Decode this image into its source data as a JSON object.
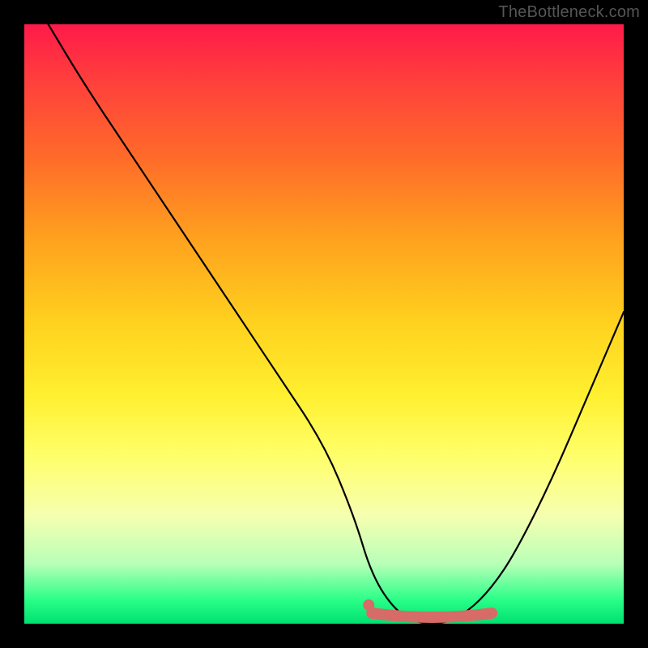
{
  "watermark": "TheBottleneck.com",
  "chart_data": {
    "type": "line",
    "title": "",
    "xlabel": "",
    "ylabel": "",
    "xlim": [
      0,
      100
    ],
    "ylim": [
      0,
      100
    ],
    "grid": false,
    "series": [
      {
        "name": "bottleneck-curve",
        "x": [
          4,
          10,
          18,
          26,
          34,
          42,
          50,
          55,
          58,
          62,
          66,
          70,
          74,
          78,
          82,
          88,
          94,
          100
        ],
        "y": [
          100,
          90,
          78,
          66,
          54,
          42,
          30,
          18,
          8,
          2,
          0,
          0,
          2,
          6,
          12,
          24,
          38,
          52
        ]
      }
    ],
    "valley_marker": {
      "name": "optimal-range",
      "color": "#d66b68",
      "x_start": 58,
      "x_end": 78,
      "y": 0
    },
    "gradient_stops": [
      {
        "pos": 0,
        "color": "#ff1a4a"
      },
      {
        "pos": 22,
        "color": "#ff6a2a"
      },
      {
        "pos": 50,
        "color": "#ffd21e"
      },
      {
        "pos": 72,
        "color": "#ffff6a"
      },
      {
        "pos": 90,
        "color": "#b8ffb8"
      },
      {
        "pos": 100,
        "color": "#00e070"
      }
    ]
  }
}
